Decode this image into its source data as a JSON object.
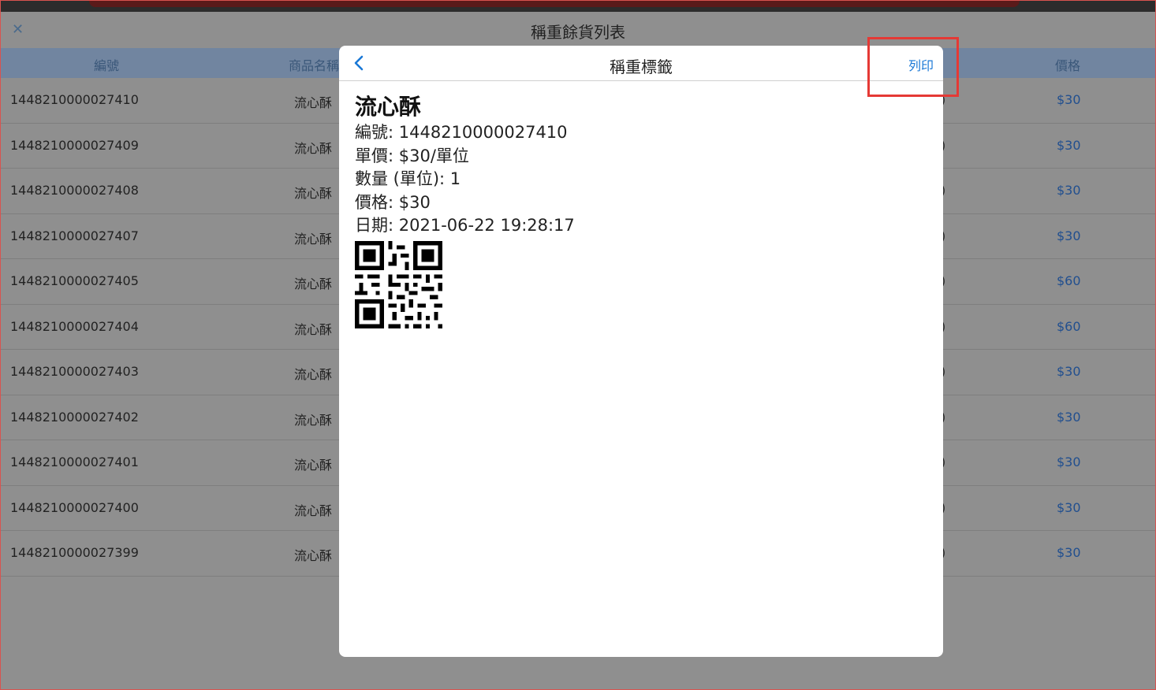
{
  "page": {
    "title": "稱重餘貨列表"
  },
  "table": {
    "headers": {
      "id": "編號",
      "name": "商品名稱",
      "price": "價格"
    },
    "rows": [
      {
        "id": "1448210000027410",
        "name": "流心酥",
        "price": "$30"
      },
      {
        "id": "1448210000027409",
        "name": "流心酥",
        "price": "$30"
      },
      {
        "id": "1448210000027408",
        "name": "流心酥",
        "price": "$30"
      },
      {
        "id": "1448210000027407",
        "name": "流心酥",
        "price": "$30"
      },
      {
        "id": "1448210000027405",
        "name": "流心酥",
        "price": "$60"
      },
      {
        "id": "1448210000027404",
        "name": "流心酥",
        "price": "$60"
      },
      {
        "id": "1448210000027403",
        "name": "流心酥",
        "price": "$30"
      },
      {
        "id": "1448210000027402",
        "name": "流心酥",
        "price": "$30"
      },
      {
        "id": "1448210000027401",
        "name": "流心酥",
        "price": "$30"
      },
      {
        "id": "1448210000027400",
        "name": "流心酥",
        "price": "$30"
      },
      {
        "id": "1448210000027399",
        "name": "流心酥",
        "price": "$30"
      }
    ]
  },
  "modal": {
    "title": "稱重標籤",
    "print_label": "列印",
    "label": {
      "name": "流心酥",
      "id_line": "編號: 1448210000027410",
      "unit_price_line": "單價: $30/單位",
      "qty_line": "數量 (單位): 1",
      "price_line": "價格: $30",
      "date_line": "日期: 2021-06-22 19:28:17"
    }
  },
  "colors": {
    "accent": "#1a78d6",
    "highlight": "#e53935",
    "price_link": "#214f8f"
  },
  "icons": {
    "close": "close-icon",
    "back": "chevron-left-icon",
    "qr": "qr-code-icon"
  }
}
